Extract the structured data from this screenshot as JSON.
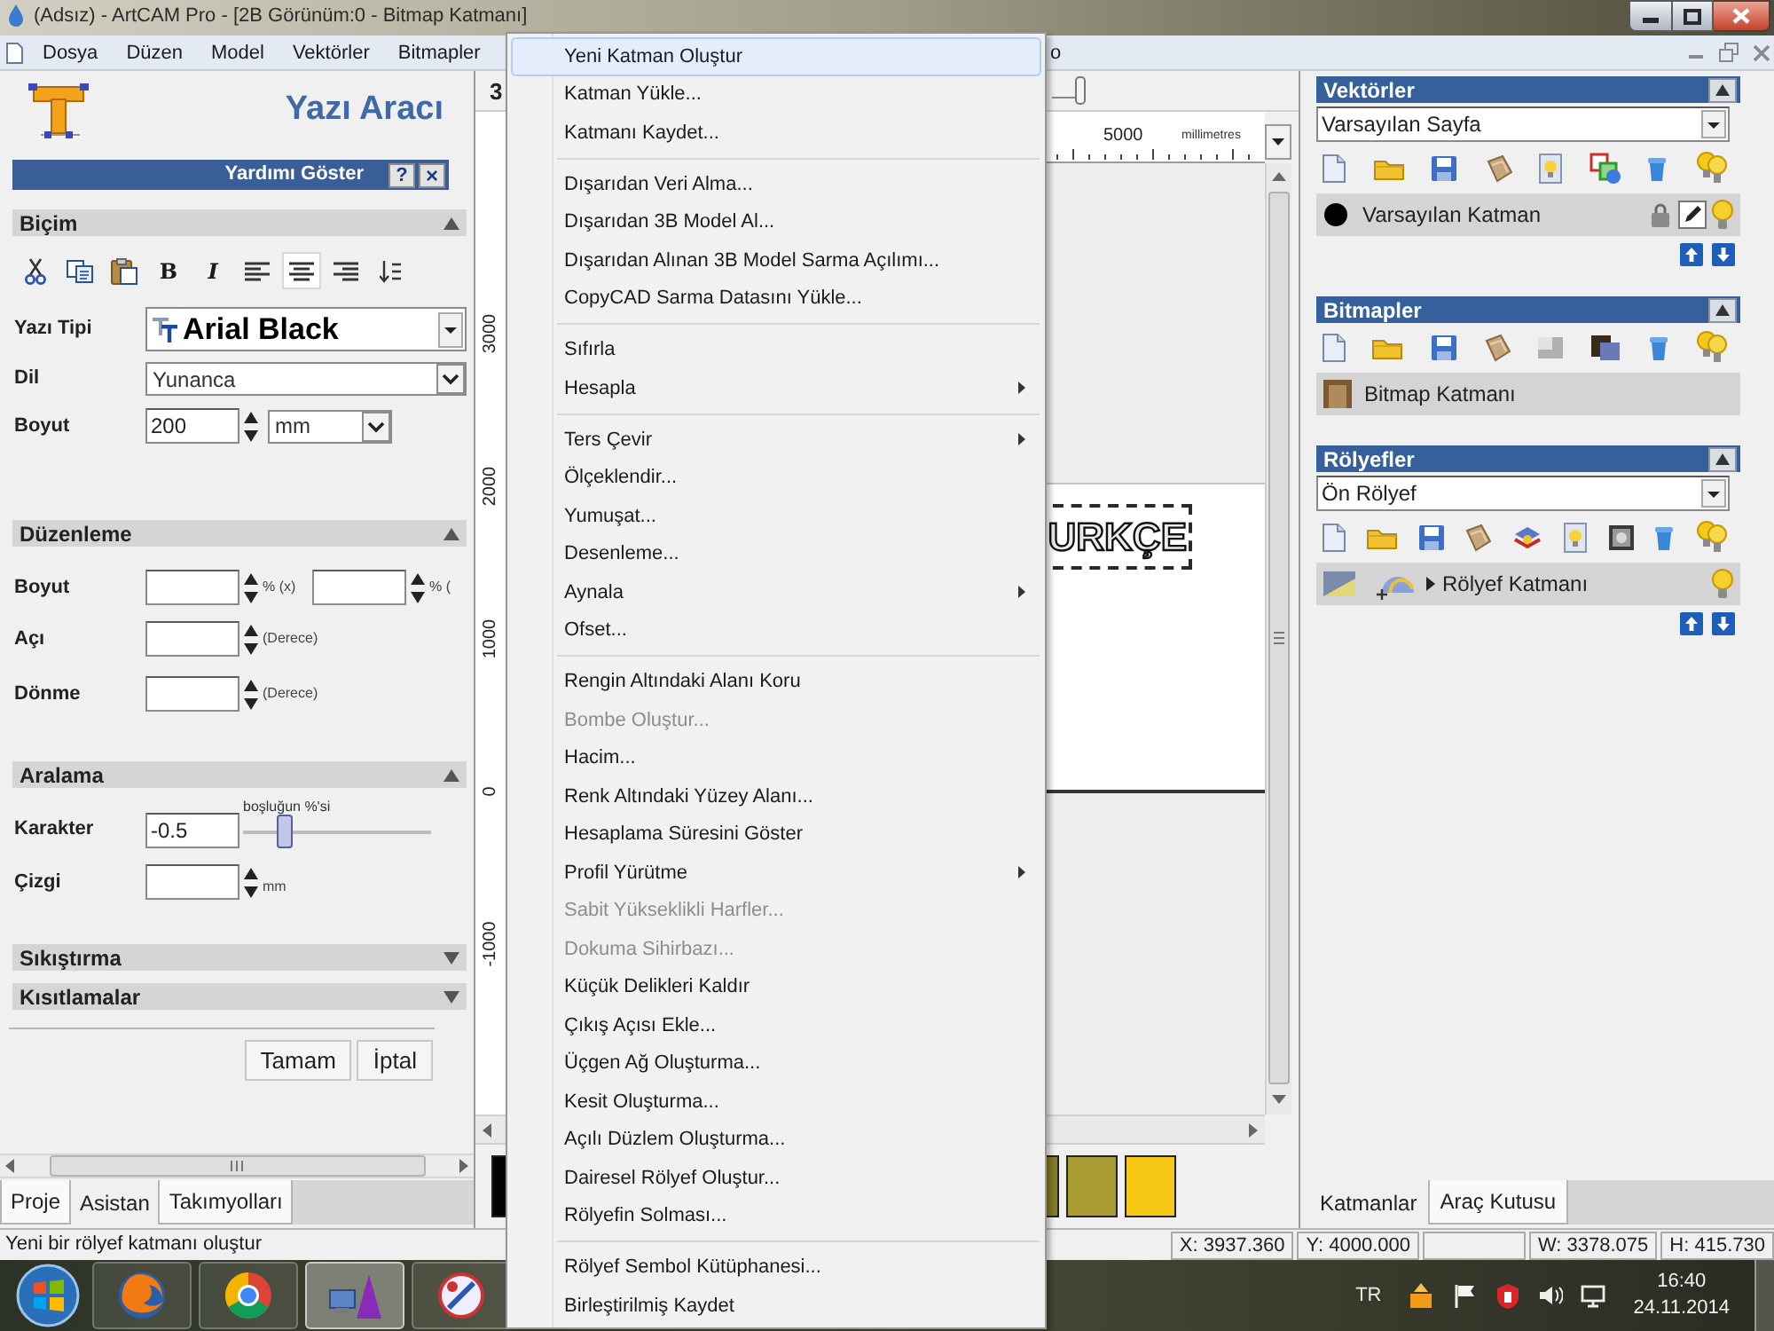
{
  "window": {
    "title": "(Adsız) - ArtCAM Pro - [2B Görünüm:0 - Bitmap Katmanı]"
  },
  "menu_bar": {
    "items": [
      "Dosya",
      "Düzen",
      "Model",
      "Vektörler",
      "Bitmapler"
    ],
    "partial_item": "o"
  },
  "text_tool": {
    "title": "Yazı Aracı",
    "help": {
      "label": "Yardımı Göster",
      "help_button": "?",
      "close_button": "×"
    },
    "format": {
      "title": "Biçim",
      "expanded": true,
      "tools": [
        {
          "kind": "cut",
          "selected": false
        },
        {
          "kind": "copy",
          "selected": false
        },
        {
          "kind": "paste",
          "selected": false
        },
        {
          "kind": "bold",
          "label": "B",
          "selected": false
        },
        {
          "kind": "italic",
          "label": "I",
          "selected": false
        },
        {
          "kind": "align_left",
          "selected": false
        },
        {
          "kind": "align_center",
          "selected": true
        },
        {
          "kind": "align_right",
          "selected": false
        },
        {
          "kind": "line_spacing",
          "selected": false
        }
      ],
      "font": {
        "label": "Yazı Tipi",
        "value": "Arial Black"
      },
      "language": {
        "label": "Dil",
        "value": "Yunanca"
      },
      "size": {
        "label": "Boyut",
        "value": "200",
        "unit": "mm"
      }
    },
    "edit": {
      "title": "Düzenleme",
      "expanded": true,
      "rows": [
        {
          "label": "Boyut",
          "fields": [
            {
              "unit": "% (x)"
            },
            {
              "unit": "% ("
            }
          ]
        },
        {
          "label": "Açı",
          "fields": [
            {
              "unit": "(Derece)"
            }
          ]
        },
        {
          "label": "Dönme",
          "fields": [
            {
              "unit": "(Derece)"
            }
          ]
        }
      ]
    },
    "spacing": {
      "title": "Aralama",
      "expanded": true,
      "character": {
        "label": "Karakter",
        "value": "-0.5",
        "slider_label": "boşluğun %'si",
        "level": 0.2
      },
      "line": {
        "label": "Çizgi",
        "unit": "mm"
      }
    },
    "more_sections": [
      {
        "title": "Sıkıştırma",
        "expanded": false
      },
      {
        "title": "Kısıtlamalar",
        "expanded": false
      }
    ],
    "buttons": [
      "Tamam",
      "İptal"
    ],
    "tabs": [
      {
        "label": "Proje",
        "selected": false
      },
      {
        "label": "Asistan",
        "selected": true
      },
      {
        "label": "Takımyolları",
        "selected": false
      }
    ]
  },
  "view": {
    "toolbar_text": "3",
    "ruler_value": "5000",
    "units": "millimetres",
    "y_labels": [
      "3000",
      "2000",
      "1000",
      "0",
      "-1000"
    ],
    "canvas_text": "URKÇE",
    "palette": [
      {
        "color": "#000000"
      },
      {
        "color": "#837a26"
      },
      {
        "color": "#a89c33"
      },
      {
        "color": "#f7c816"
      }
    ]
  },
  "dropdown_menu": {
    "items": [
      {
        "kind": "item",
        "label": "Yeni Katman Oluştur",
        "selected": true,
        "disabled": false,
        "submenu": false
      },
      {
        "kind": "item",
        "label": "Katman Yükle...",
        "selected": false,
        "disabled": false,
        "submenu": false
      },
      {
        "kind": "item",
        "label": "Katmanı Kaydet...",
        "selected": false,
        "disabled": false,
        "submenu": false
      },
      {
        "kind": "separator"
      },
      {
        "kind": "item",
        "label": "Dışarıdan Veri Alma...",
        "selected": false,
        "disabled": false,
        "submenu": false
      },
      {
        "kind": "item",
        "label": "Dışarıdan 3B Model Al...",
        "selected": false,
        "disabled": false,
        "submenu": false
      },
      {
        "kind": "item",
        "label": "Dışarıdan Alınan 3B Model Sarma Açılımı...",
        "selected": false,
        "disabled": false,
        "submenu": false
      },
      {
        "kind": "item",
        "label": "CopyCAD Sarma Datasını Yükle...",
        "selected": false,
        "disabled": false,
        "submenu": false
      },
      {
        "kind": "separator"
      },
      {
        "kind": "item",
        "label": "Sıfırla",
        "selected": false,
        "disabled": false,
        "submenu": false
      },
      {
        "kind": "item",
        "label": "Hesapla",
        "selected": false,
        "disabled": false,
        "submenu": true
      },
      {
        "kind": "separator"
      },
      {
        "kind": "item",
        "label": "Ters Çevir",
        "selected": false,
        "disabled": false,
        "submenu": true
      },
      {
        "kind": "item",
        "label": "Ölçeklendir...",
        "selected": false,
        "disabled": false,
        "submenu": false
      },
      {
        "kind": "item",
        "label": "Yumuşat...",
        "selected": false,
        "disabled": false,
        "submenu": false
      },
      {
        "kind": "item",
        "label": "Desenleme...",
        "selected": false,
        "disabled": false,
        "submenu": false
      },
      {
        "kind": "item",
        "label": "Aynala",
        "selected": false,
        "disabled": false,
        "submenu": true
      },
      {
        "kind": "item",
        "label": "Ofset...",
        "selected": false,
        "disabled": false,
        "submenu": false
      },
      {
        "kind": "separator"
      },
      {
        "kind": "item",
        "label": "Rengin Altındaki Alanı Koru",
        "selected": false,
        "disabled": false,
        "submenu": false
      },
      {
        "kind": "item",
        "label": "Bombe Oluştur...",
        "selected": false,
        "disabled": true,
        "submenu": false
      },
      {
        "kind": "item",
        "label": "Hacim...",
        "selected": false,
        "disabled": false,
        "submenu": false
      },
      {
        "kind": "item",
        "label": "Renk Altındaki Yüzey Alanı...",
        "selected": false,
        "disabled": false,
        "submenu": false
      },
      {
        "kind": "item",
        "label": "Hesaplama Süresini Göster",
        "selected": false,
        "disabled": false,
        "submenu": false
      },
      {
        "kind": "item",
        "label": "Profil Yürütme",
        "selected": false,
        "disabled": false,
        "submenu": true
      },
      {
        "kind": "item",
        "label": "Sabit Yükseklikli Harfler...",
        "selected": false,
        "disabled": true,
        "submenu": false
      },
      {
        "kind": "item",
        "label": "Dokuma Sihirbazı...",
        "selected": false,
        "disabled": true,
        "submenu": false
      },
      {
        "kind": "item",
        "label": "Küçük Delikleri Kaldır",
        "selected": false,
        "disabled": false,
        "submenu": false
      },
      {
        "kind": "item",
        "label": "Çıkış Açısı Ekle...",
        "selected": false,
        "disabled": false,
        "submenu": false
      },
      {
        "kind": "item",
        "label": "Üçgen Ağ Oluşturma...",
        "selected": false,
        "disabled": false,
        "submenu": false
      },
      {
        "kind": "item",
        "label": "Kesit Oluşturma...",
        "selected": false,
        "disabled": false,
        "submenu": false
      },
      {
        "kind": "item",
        "label": "Açılı Düzlem Oluşturma...",
        "selected": false,
        "disabled": false,
        "submenu": false
      },
      {
        "kind": "item",
        "label": "Dairesel Rölyef Oluştur...",
        "selected": false,
        "disabled": false,
        "submenu": false
      },
      {
        "kind": "item",
        "label": "Rölyefin Solması...",
        "selected": false,
        "disabled": false,
        "submenu": false
      },
      {
        "kind": "separator"
      },
      {
        "kind": "item",
        "label": "Rölyef Sembol Kütüphanesi...",
        "selected": false,
        "disabled": false,
        "submenu": false
      },
      {
        "kind": "item",
        "label": "Birleştirilmiş Kaydet",
        "selected": false,
        "disabled": false,
        "submenu": false
      }
    ]
  },
  "layers_panel": {
    "sections": [
      {
        "title": "Vektörler",
        "expanded": true,
        "select": "Varsayılan Sayfa",
        "tools": [
          {
            "kind": "new"
          },
          {
            "kind": "open"
          },
          {
            "kind": "save"
          },
          {
            "kind": "sheets"
          },
          {
            "kind": "bulb_page"
          },
          {
            "kind": "overlap"
          },
          {
            "kind": "delete"
          },
          {
            "kind": "bulbs"
          }
        ],
        "layers": [
          {
            "kind": "vector",
            "name": "Varsayılan Katman",
            "color": "#000000",
            "visible": true
          }
        ],
        "order_buttons": true
      },
      {
        "title": "Bitmapler",
        "expanded": true,
        "tools": [
          {
            "kind": "new"
          },
          {
            "kind": "open"
          },
          {
            "kind": "save"
          },
          {
            "kind": "sheets"
          },
          {
            "kind": "gray_square"
          },
          {
            "kind": "picture"
          },
          {
            "kind": "delete"
          },
          {
            "kind": "bulbs"
          }
        ],
        "layers": [
          {
            "kind": "bitmap",
            "name": "Bitmap Katmanı"
          }
        ]
      },
      {
        "title": "Rölyefler",
        "expanded": true,
        "select": "Ön Rölyef",
        "tools": [
          {
            "kind": "new"
          },
          {
            "kind": "open"
          },
          {
            "kind": "save"
          },
          {
            "kind": "sheets"
          },
          {
            "kind": "stack"
          },
          {
            "kind": "bulb_page"
          },
          {
            "kind": "image"
          },
          {
            "kind": "delete"
          },
          {
            "kind": "bulbs"
          }
        ],
        "layers": [
          {
            "kind": "relief",
            "name": "Rölyef Katmanı",
            "expanded": false,
            "visible": true
          }
        ],
        "order_buttons": true
      }
    ],
    "tabs": [
      {
        "label": "Katmanlar",
        "selected": true
      },
      {
        "label": "Araç Kutusu",
        "selected": false
      }
    ]
  },
  "status_bar": {
    "message": "Yeni bir rölyef katmanı oluştur",
    "fields": [
      {
        "kind": "text",
        "text": "X: 3937.360"
      },
      {
        "kind": "text",
        "text": "Y: 4000.000"
      },
      {
        "kind": "empty"
      },
      {
        "kind": "text",
        "text": "W: 3378.075"
      },
      {
        "kind": "text",
        "text": "H: 415.730"
      }
    ]
  },
  "taskbar": {
    "apps": [
      {
        "kind": "fox",
        "selected": false
      },
      {
        "kind": "chrome",
        "selected": false
      },
      {
        "kind": "design",
        "selected": true
      },
      {
        "kind": "tool",
        "selected": false
      }
    ],
    "language": "TR",
    "time": "16:40",
    "date": "24.11.2014"
  }
}
